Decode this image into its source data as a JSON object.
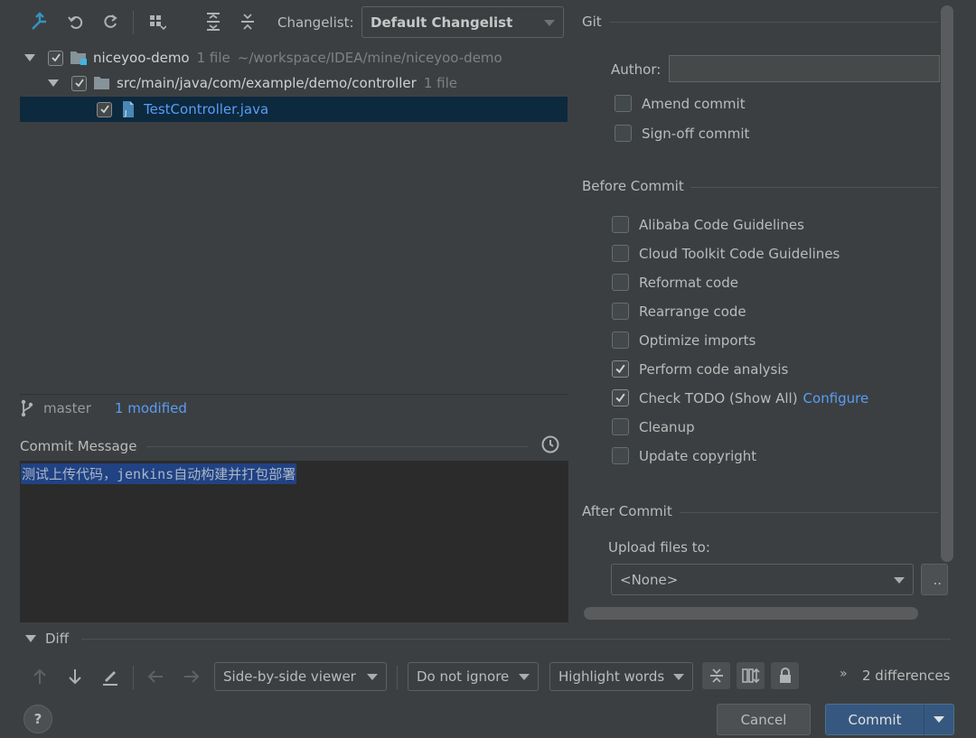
{
  "toolbar": {
    "changelist_label": "Changelist:",
    "changelist_value": "Default Changelist"
  },
  "tree": {
    "root": {
      "name": "niceyoo-demo",
      "count": "1 file",
      "path": "~/workspace/IDEA/mine/niceyoo-demo"
    },
    "folder": {
      "name": "src/main/java/com/example/demo/controller",
      "count": "1 file"
    },
    "file": {
      "name": "TestController.java"
    }
  },
  "status": {
    "branch": "master",
    "modified": "1 modified"
  },
  "commit_message": {
    "label": "Commit Message",
    "text": "测试上传代码，jenkins自动构建并打包部署"
  },
  "git": {
    "title": "Git",
    "author_label": "Author:",
    "author_value": "",
    "amend": {
      "label": "Amend commit",
      "checked": false
    },
    "signoff": {
      "label": "Sign-off commit",
      "checked": false
    }
  },
  "before_commit": {
    "title": "Before Commit",
    "items": [
      {
        "label": "Alibaba Code Guidelines",
        "checked": false
      },
      {
        "label": "Cloud Toolkit Code Guidelines",
        "checked": false
      },
      {
        "label": "Reformat code",
        "checked": false
      },
      {
        "label": "Rearrange code",
        "checked": false
      },
      {
        "label": "Optimize imports",
        "checked": false
      },
      {
        "label": "Perform code analysis",
        "checked": true
      },
      {
        "label": "Check TODO (Show All)",
        "checked": true,
        "link": "Configure"
      },
      {
        "label": "Cleanup",
        "checked": false
      },
      {
        "label": "Update copyright",
        "checked": false
      }
    ]
  },
  "after_commit": {
    "title": "After Commit",
    "upload_label": "Upload files to:",
    "upload_value": "<None>",
    "more": ".."
  },
  "diff": {
    "title": "Diff",
    "viewer": "Side-by-side viewer",
    "ignore": "Do not ignore",
    "highlight": "Highlight words",
    "differences": "2 differences",
    "more": "»"
  },
  "footer": {
    "help": "?",
    "cancel": "Cancel",
    "commit": "Commit"
  },
  "colors": {
    "background": "#3c3f41",
    "selection": "#0d293e",
    "link": "#589df6",
    "primary_button": "#365880"
  }
}
